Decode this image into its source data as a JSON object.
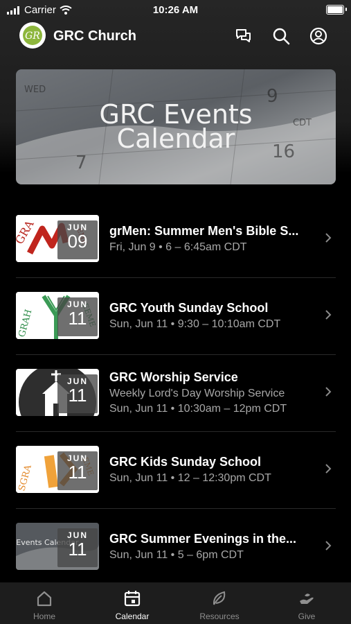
{
  "status_bar": {
    "carrier": "Carrier",
    "time": "10:26 AM"
  },
  "header": {
    "title": "GRC Church",
    "logo_text": "GR",
    "icons": [
      "chat-icon",
      "search-icon",
      "account-icon"
    ]
  },
  "hero": {
    "line1": "GRC Events",
    "line2": "Calendar",
    "calendar_marks": [
      "WED",
      "9",
      "7",
      "16",
      "CDT"
    ]
  },
  "events": [
    {
      "title": "grMen: Summer Men's Bible S...",
      "subtitle": "Fri, Jun 9 • 6 – 6:45am CDT",
      "month": "JUN",
      "day": "09"
    },
    {
      "title": "GRC Youth Sunday School",
      "subtitle": "Sun, Jun 11 • 9:30 – 10:10am CDT",
      "month": "JUN",
      "day": "11"
    },
    {
      "title": "GRC Worship Service",
      "subtitle": "Weekly Lord's Day Worship Service",
      "subtitle2": "Sun, Jun 11 • 10:30am – 12pm CDT",
      "month": "JUN",
      "day": "11"
    },
    {
      "title": "GRC Kids Sunday School",
      "subtitle": "Sun, Jun 11 • 12 – 12:30pm CDT",
      "month": "JUN",
      "day": "11"
    },
    {
      "title": "GRC Summer Evenings in the...",
      "subtitle": "Sun, Jun 11 • 5 – 6pm CDT",
      "month": "JUN",
      "day": "11",
      "thumb_text": "GRC Events Calendar"
    }
  ],
  "tabs": [
    {
      "label": "Home",
      "icon": "home-icon",
      "active": false
    },
    {
      "label": "Calendar",
      "icon": "calendar-icon",
      "active": true
    },
    {
      "label": "Resources",
      "icon": "leaf-icon",
      "active": false
    },
    {
      "label": "Give",
      "icon": "give-icon",
      "active": false
    }
  ],
  "colors": {
    "background": "#000000",
    "tabbar": "#1d1d1d",
    "muted_text": "#a8a8a8",
    "logo_green": "#8db63c",
    "accent_red": "#b8241d"
  }
}
